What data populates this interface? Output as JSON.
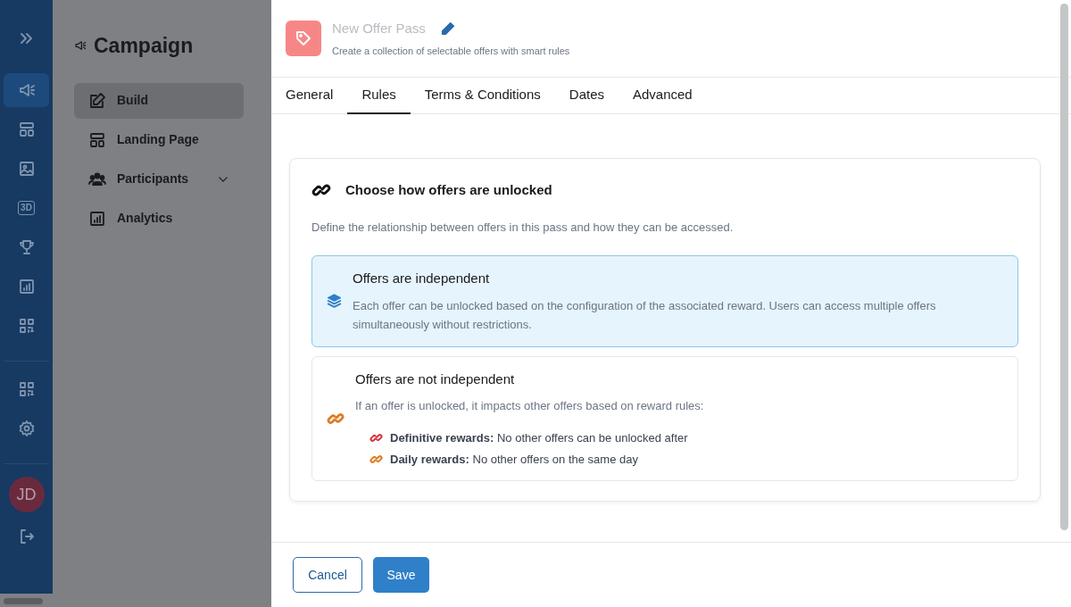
{
  "rail": {
    "items": [
      {
        "selected": false
      },
      {
        "selected": true
      },
      {
        "selected": false
      },
      {
        "selected": false
      },
      {
        "selected": false,
        "label": "3D"
      },
      {
        "selected": false
      },
      {
        "selected": false
      },
      {
        "selected": false
      }
    ],
    "bottom_items": [
      {
        "selected": false
      },
      {
        "selected": false
      }
    ],
    "avatar": "JD"
  },
  "campaign": {
    "title": "Campaign",
    "menu": [
      {
        "label": "Build",
        "selected": true,
        "expandable": false
      },
      {
        "label": "Landing Page",
        "selected": false,
        "expandable": false
      },
      {
        "label": "Participants",
        "selected": false,
        "expandable": true
      },
      {
        "label": "Analytics",
        "selected": false,
        "expandable": false
      }
    ]
  },
  "drawer": {
    "title": "New Offer Pass",
    "subtitle": "Create a collection of selectable offers with smart rules",
    "tabs": [
      {
        "label": "General",
        "selected": false
      },
      {
        "label": "Rules",
        "selected": true
      },
      {
        "label": "Terms & Conditions",
        "selected": false
      },
      {
        "label": "Dates",
        "selected": false
      },
      {
        "label": "Advanced",
        "selected": false
      }
    ],
    "card": {
      "title": "Choose how offers are unlocked",
      "description": "Define the relationship between offers in this pass and how they can be accessed.",
      "options": [
        {
          "kind": "independent",
          "selected": true,
          "title": "Offers are independent",
          "description": "Each offer can be unlocked based on the configuration of the associated reward. Users can access multiple offers simultaneously without restrictions."
        },
        {
          "kind": "dependent",
          "selected": false,
          "title": "Offers are not independent",
          "description": "If an offer is unlocked, it impacts other offers based on reward rules:",
          "rules": [
            {
              "text": "**Definitive rewards:** No other offers can be unlocked after",
              "color": "#d9363e"
            },
            {
              "text": "**Daily rewards:** No other offers on the same day",
              "color": "#e07b24"
            }
          ]
        }
      ]
    },
    "buttons": {
      "cancel": "Cancel",
      "save": "Save"
    }
  }
}
